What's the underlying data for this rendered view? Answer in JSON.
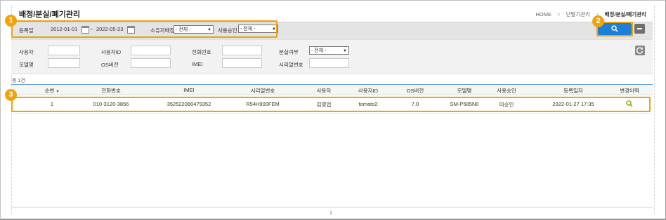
{
  "page": {
    "title": "배정/분실/폐기관리",
    "breadcrumb": [
      "HOME",
      "단말기관리",
      "배정/분실/폐기관리"
    ],
    "separator": ">"
  },
  "topbar": {
    "reg_date_label": "등록일",
    "date_from": "2012-01-01",
    "date_sep": "~",
    "date_to": "2022-05-23",
    "owner_label": "소유자배정",
    "owner_value": "- 전체 -",
    "approval_label": "사용승인",
    "approval_value": "- 전체 -"
  },
  "filters": {
    "user_label": "사용자",
    "userid_label": "사용자ID",
    "phone_label": "전화번호",
    "lost_label": "분실여부",
    "lost_value": "- 전체 -",
    "model_label": "모델명",
    "os_label": "OS버전",
    "imei_label": "IMEI",
    "serial_label": "시리얼번호"
  },
  "table": {
    "total": "총 1건",
    "sort_mark": "▼",
    "headers": [
      "순번",
      "전화번호",
      "IMEI",
      "시리얼번호",
      "사용자",
      "사용자ID",
      "OS버전",
      "모델명",
      "사용승인",
      "등록일자",
      "변경이력"
    ],
    "rows": [
      [
        "1",
        "010-3120-3856",
        "352522080479352",
        "R54H900FEM",
        "김영업",
        "tomato2",
        "7.0",
        "SM-P585N0",
        "미승인",
        "2022-01-27 17:35"
      ]
    ]
  },
  "pagination": {
    "current": "1"
  },
  "badges": [
    "1",
    "2",
    "3"
  ],
  "colors": {
    "accent": "#f0a30a",
    "primary": "#1e7fd6",
    "history_icon": "#8ab21e"
  },
  "icons": {
    "search": "search-icon",
    "minus": "minus-icon",
    "refresh": "refresh-icon",
    "calendar": "calendar-icon",
    "history": "history-search-icon"
  }
}
